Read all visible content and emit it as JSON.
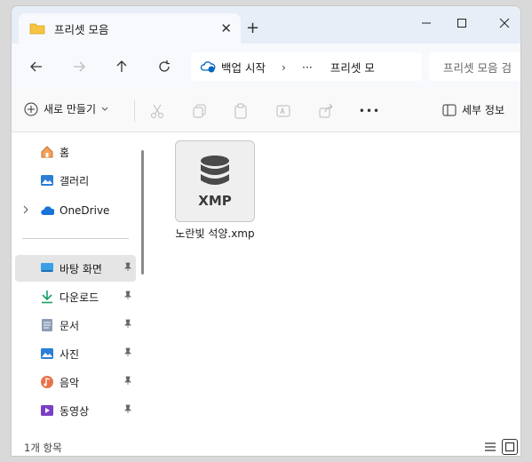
{
  "tab": {
    "title": "프리셋 모음",
    "close": "✕",
    "new_tab": "+"
  },
  "window_controls": {
    "minimize": "—",
    "maximize": "☐",
    "close": "✕"
  },
  "address": {
    "segment1": "백업 시작",
    "sep1": "›",
    "ellipsis": "···",
    "segment2": "프리셋 모"
  },
  "search": {
    "placeholder": "프리셋 모음 검"
  },
  "commands": {
    "new_label": "새로 만들기",
    "more": "•••",
    "details_label": "세부 정보"
  },
  "sidebar": {
    "items": [
      {
        "label": "홈",
        "icon": "home-icon"
      },
      {
        "label": "갤러리",
        "icon": "gallery-icon"
      },
      {
        "label": "OneDrive",
        "icon": "onedrive-icon"
      },
      {
        "label": "바탕 화면",
        "icon": "desktop-icon",
        "pinned": true,
        "selected": true
      },
      {
        "label": "다운로드",
        "icon": "download-icon",
        "pinned": true
      },
      {
        "label": "문서",
        "icon": "documents-icon",
        "pinned": true
      },
      {
        "label": "사진",
        "icon": "pictures-icon",
        "pinned": true
      },
      {
        "label": "음악",
        "icon": "music-icon",
        "pinned": true
      },
      {
        "label": "동영상",
        "icon": "videos-icon",
        "pinned": true
      }
    ]
  },
  "files": [
    {
      "name": "노란빛 석양.xmp",
      "badge": "XMP"
    }
  ],
  "status": {
    "count": "1개 항목"
  },
  "colors": {
    "accent": "#0067c0",
    "folder": "#f6c342",
    "titlebar": "#e8eef8"
  }
}
